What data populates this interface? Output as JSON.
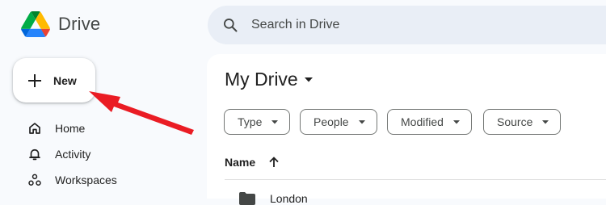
{
  "app": {
    "name": "Drive",
    "logo_icon": "google-drive-logo-icon"
  },
  "search": {
    "placeholder": "Search in Drive",
    "icon": "search-icon"
  },
  "new_button": {
    "label": "New",
    "icon": "plus-icon"
  },
  "sidebar": {
    "items": [
      {
        "label": "Home",
        "icon": "home-icon"
      },
      {
        "label": "Activity",
        "icon": "bell-icon"
      },
      {
        "label": "Workspaces",
        "icon": "workspaces-icon"
      }
    ]
  },
  "main": {
    "title": "My Drive",
    "filters": [
      {
        "label": "Type"
      },
      {
        "label": "People"
      },
      {
        "label": "Modified"
      },
      {
        "label": "Source"
      }
    ],
    "columns": {
      "name": "Name",
      "sort_icon": "arrow-up-icon"
    },
    "rows": [
      {
        "name": "London",
        "icon": "folder-icon"
      }
    ]
  },
  "annotation": {
    "color": "#ea1c24",
    "icon": "red-arrow-annotation"
  },
  "colors": {
    "background": "#f8fafd",
    "search_bg": "#e9eef6",
    "text": "#1f1f1f"
  }
}
